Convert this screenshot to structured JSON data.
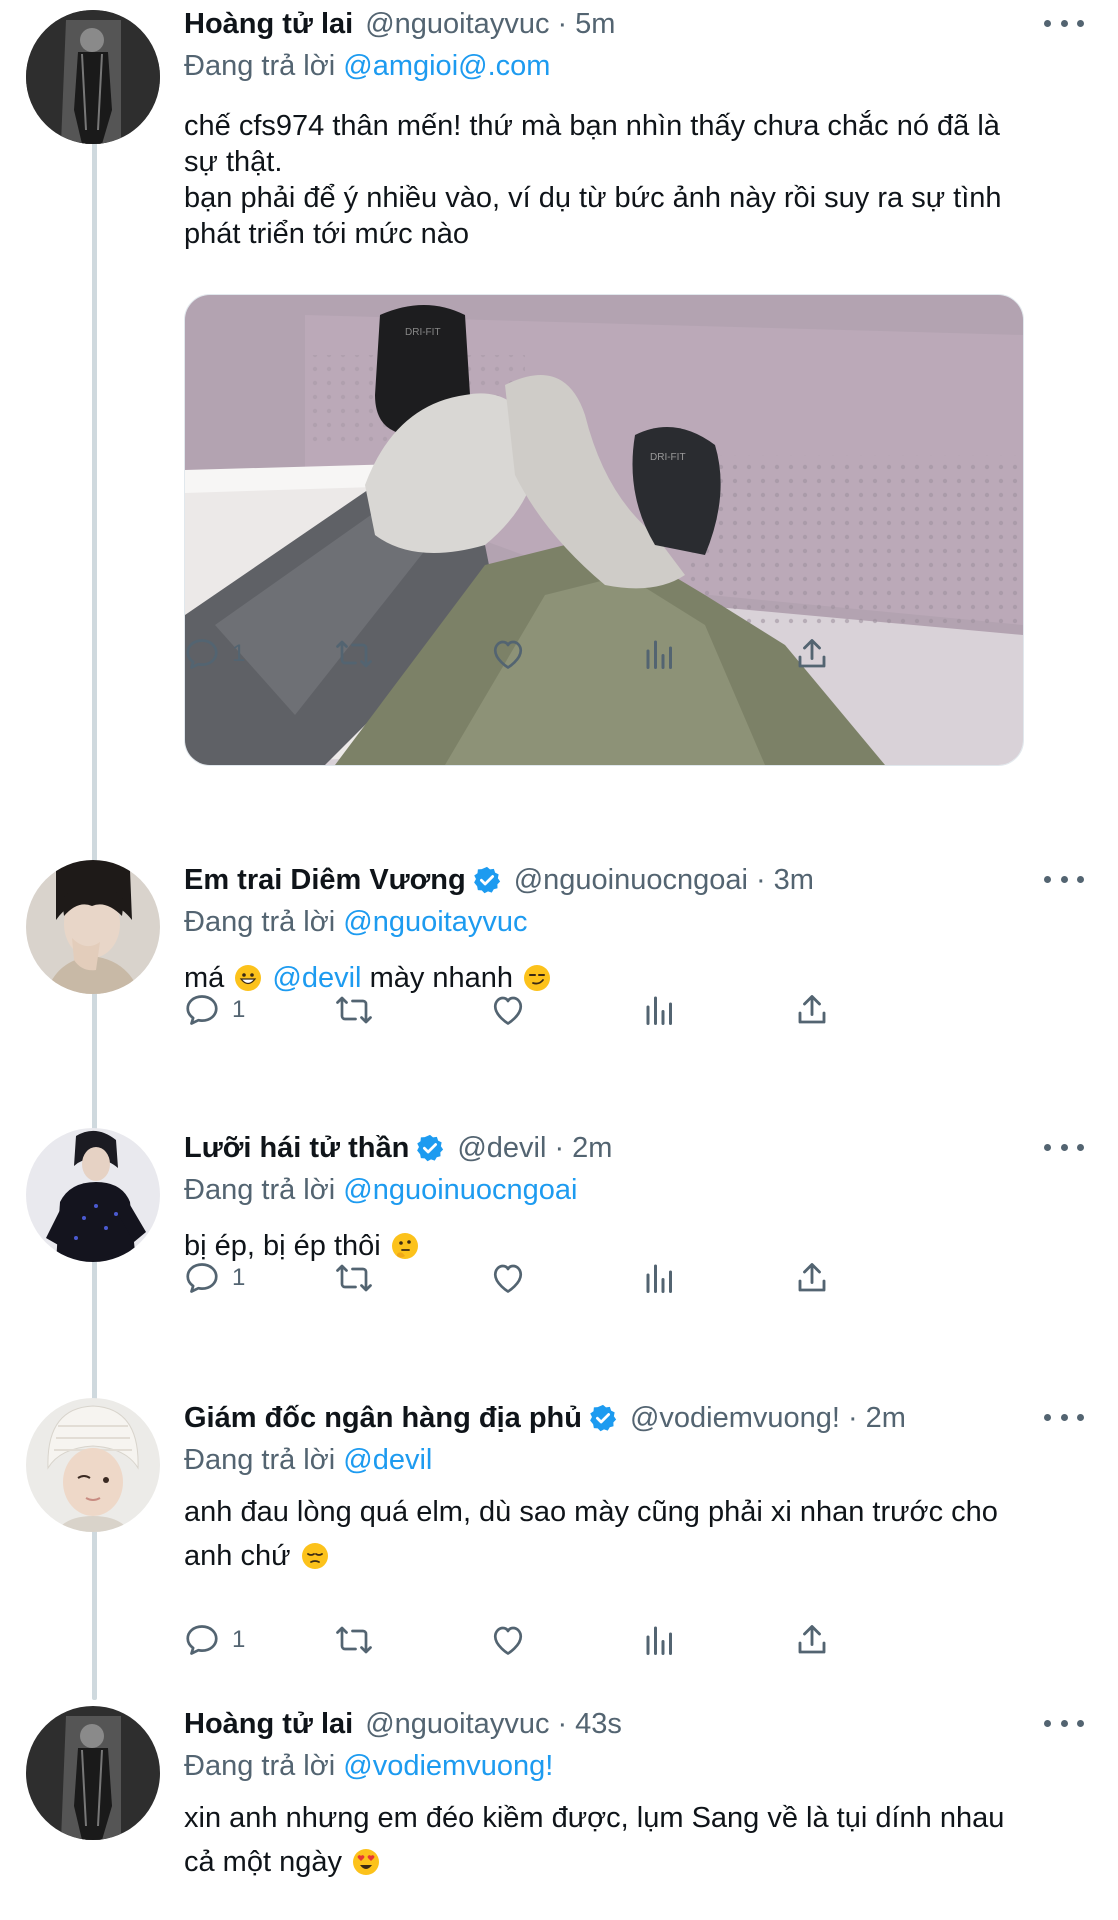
{
  "colors": {
    "accent": "#1d9bf0",
    "secondary_text": "#536471",
    "primary_text": "#0f1419",
    "thread_line": "#cfd9de"
  },
  "tweets": [
    {
      "name": "Hoàng tử lai",
      "verified": false,
      "handle": "@nguoitayvuc",
      "separator": "·",
      "time": "5m",
      "replying_label": "Đang trả lời",
      "replying_to": "@amgioi@.com",
      "text_lines": [
        "chế cfs974 thân mến! thứ mà bạn nhìn thấy chưa chắc nó đã là",
        "sự thật.",
        "bạn phải để ý nhiều vào, ví dụ từ bức ảnh này rồi suy ra sự tình",
        "phát triển tới mức nào"
      ],
      "media": "photo-feet-in-socks-on-bed",
      "reply_count": "1"
    },
    {
      "name": "Em trai Diêm Vương",
      "verified": true,
      "handle": "@nguoinuocngoai",
      "separator": "·",
      "time": "3m",
      "replying_label": "Đang trả lời",
      "replying_to": "@nguoitayvuc",
      "text_before": "má",
      "emoji_1": "grinning-face-emoji",
      "mention": "@devil",
      "text_after": "mày nhanh",
      "emoji_2": "smirking-face-emoji",
      "reply_count": "1"
    },
    {
      "name": "Lưỡi hái tử thần",
      "verified": true,
      "handle": "@devil",
      "separator": "·",
      "time": "2m",
      "replying_label": "Đang trả lời",
      "replying_to": "@nguoinuocngoai",
      "text": "bị ép, bị ép thôi",
      "emoji": "thinking-face-emoji",
      "reply_count": "1"
    },
    {
      "name": "Giám đốc ngân hàng địa phủ",
      "verified": true,
      "handle": "@vodiemvuong!",
      "separator": "·",
      "time": "2m",
      "replying_label": "Đang trả lời",
      "replying_to": "@devil",
      "text_lines": [
        "anh đau lòng quá elm, dù sao mày cũng phải xi nhan trước cho",
        "anh chứ"
      ],
      "emoji": "pensive-face-emoji",
      "reply_count": "1"
    },
    {
      "name": "Hoàng tử lai",
      "verified": false,
      "handle": "@nguoitayvuc",
      "separator": "·",
      "time": "43s",
      "replying_label": "Đang trả lời",
      "replying_to": "@vodiemvuong!",
      "text_lines": [
        "xin anh nhưng em đéo kiềm được, lụm Sang về là tụi dính nhau",
        "cả một ngày"
      ],
      "emoji": "heart-eyes-emoji"
    }
  ],
  "action_icons": [
    "reply-icon",
    "retweet-icon",
    "like-icon",
    "analytics-icon",
    "share-icon"
  ]
}
